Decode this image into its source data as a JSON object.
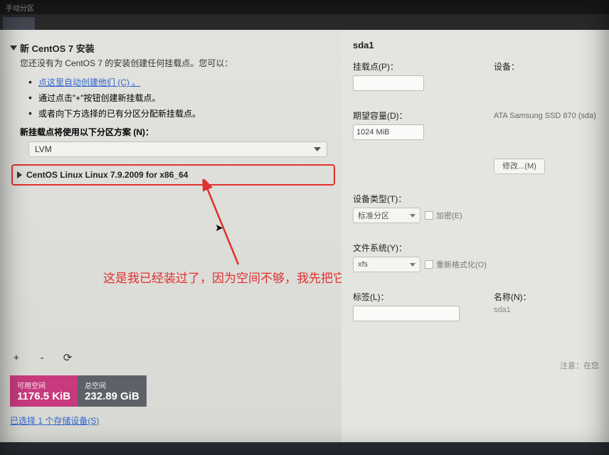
{
  "top": {
    "left": "手动分区",
    "right": ""
  },
  "tabs": [
    ""
  ],
  "left": {
    "title": "新 CentOS 7 安装",
    "desc": "您还没有为 CentOS 7 的安装创建任何挂载点。您可以：",
    "bullets": [
      {
        "type": "link",
        "text": "点这里自动创建他们 (C) 。"
      },
      {
        "type": "text",
        "text": "通过点击\"+\"按钮创建新挂载点。"
      },
      {
        "type": "text",
        "text": "或者向下方选择的已有分区分配新挂载点。"
      }
    ],
    "scheme_label": "新挂载点将使用以下分区方案 (N)：",
    "scheme_value": "LVM",
    "centos_item": "CentOS Linux Linux 7.9.2009 for x86_64",
    "add": "+",
    "remove": "-",
    "reload": "⟳",
    "avail_label": "可用空间",
    "avail_value": "1176.5 KiB",
    "total_label": "总空间",
    "total_value": "232.89 GiB",
    "storage_link": "已选择 1 个存储设备(S)"
  },
  "right": {
    "title": "sda1",
    "mount_label": "挂载点(P)：",
    "mount_value": "",
    "device_label": "设备：",
    "capacity_label": "期望容量(D)：",
    "capacity_value": "1024 MiB",
    "device_value": "ATA Samsung SSD 870 (sda)",
    "modify_btn": "修改...(M)",
    "devtype_label": "设备类型(T)：",
    "devtype_value": "标准分区",
    "encrypt_label": "加密(E)",
    "fs_label": "文件系统(Y)：",
    "fs_value": "xfs",
    "reformat_label": "重新格式化(O)",
    "tag_label": "标签(L)：",
    "tag_value": "",
    "name_label": "名称(N)：",
    "name_value": "sda1",
    "hint": "注意：在您"
  },
  "annotation": "这是我已经装过了，因为空间不够，我先把它删除了"
}
